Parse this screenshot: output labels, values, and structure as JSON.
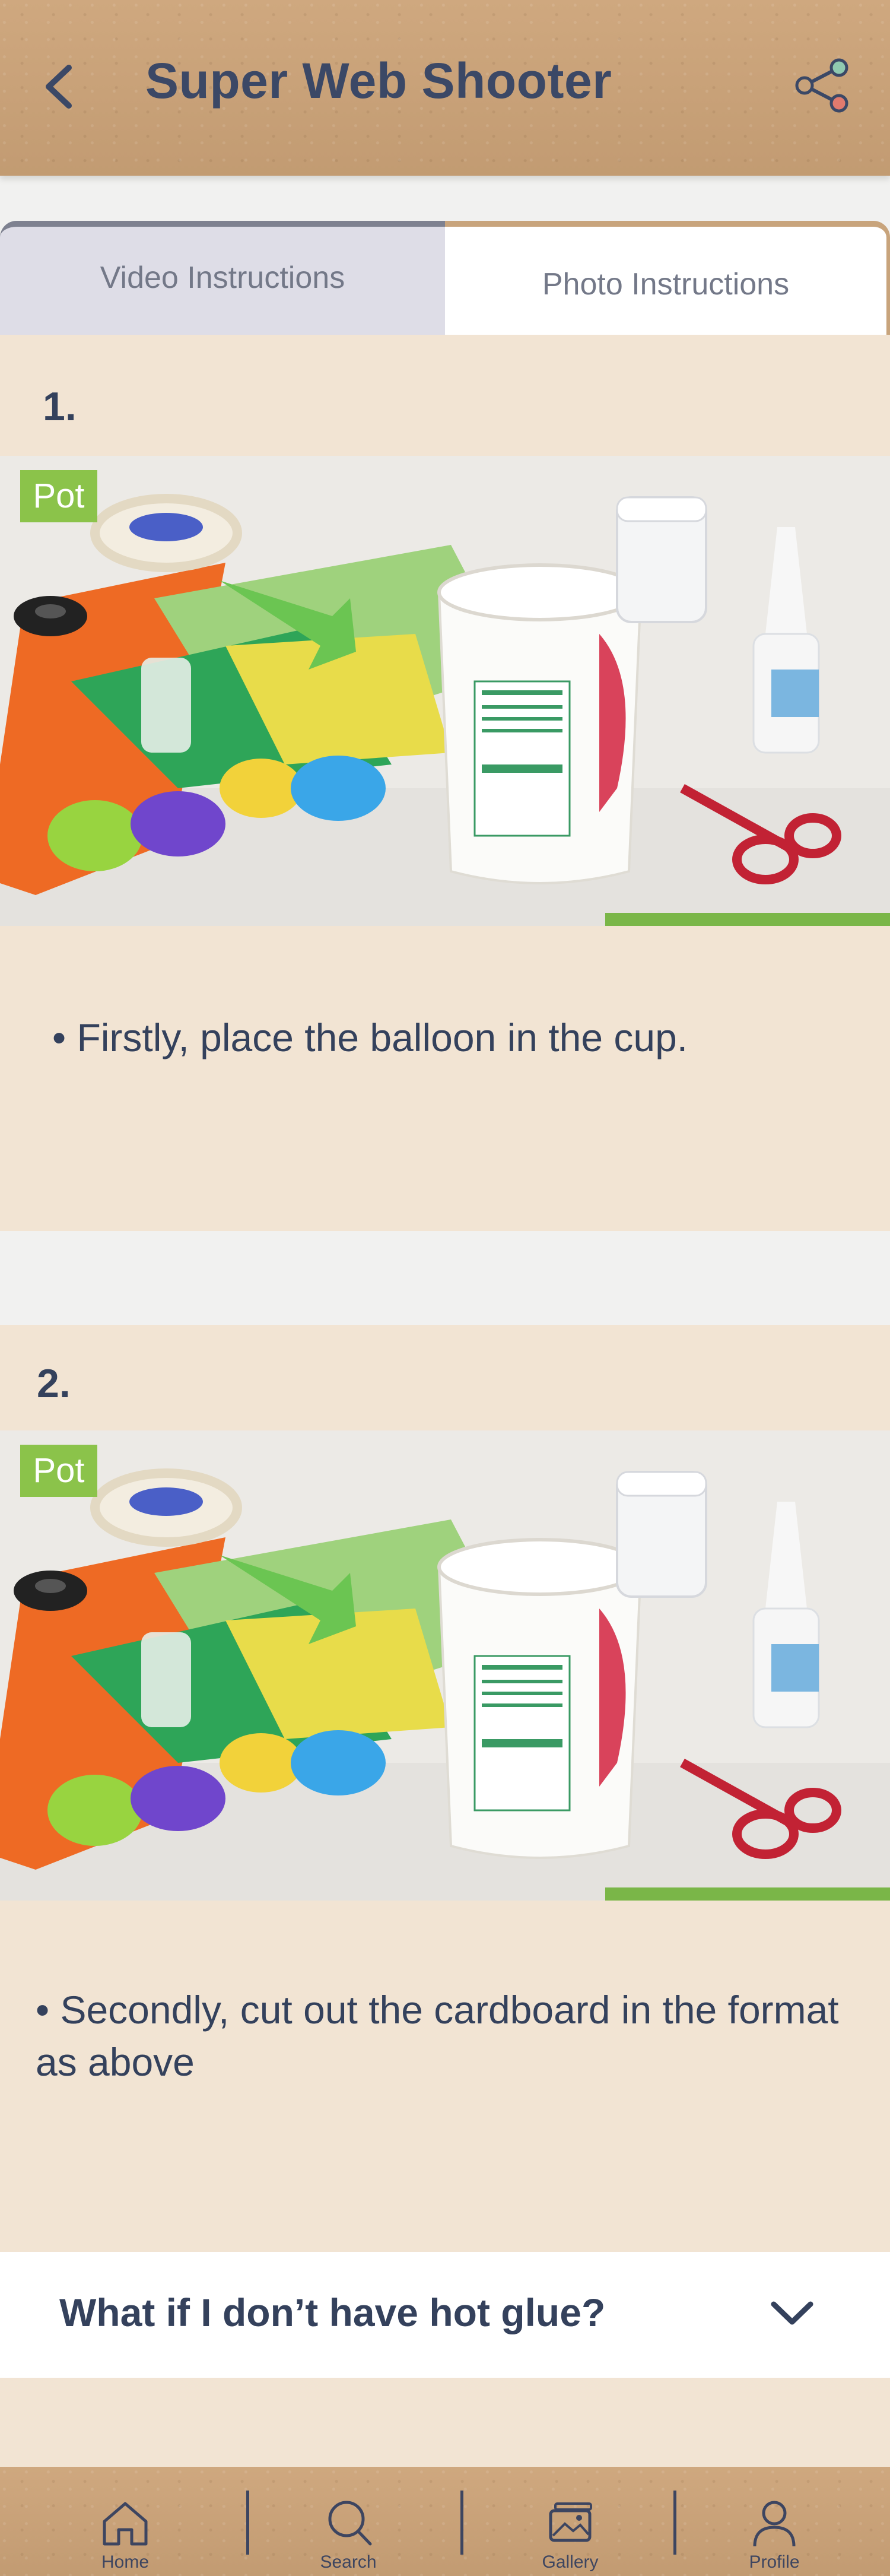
{
  "header": {
    "title": "Super Web Shooter",
    "back_icon": "chevron-left-icon",
    "share_icon": "share-icon"
  },
  "tabs": [
    {
      "label": "Video Instructions",
      "active": false
    },
    {
      "label": "Photo Instructions",
      "active": true
    }
  ],
  "steps": [
    {
      "number": "1.",
      "image_badge": "Pot",
      "text": "• Firstly, place the balloon in the cup."
    },
    {
      "number": "2.",
      "image_badge": "Pot",
      "text": "• Secondly, cut out the cardboard in the format as above"
    }
  ],
  "faq": {
    "question": "What if I don’t have hot glue?",
    "chevron_icon": "chevron-down-icon"
  },
  "bottom_nav": [
    {
      "label": "Home",
      "icon": "home-icon"
    },
    {
      "label": "Search",
      "icon": "search-icon"
    },
    {
      "label": "Gallery",
      "icon": "gallery-icon"
    },
    {
      "label": "Profile",
      "icon": "profile-icon"
    }
  ],
  "colors": {
    "text_dark": "#34415c",
    "card_bg": "#f2e4d3",
    "kraft": "#c8a27a",
    "badge_green": "#8bc34a"
  }
}
